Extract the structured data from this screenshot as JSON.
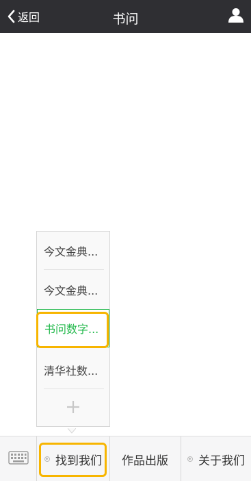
{
  "header": {
    "back_label": "返回",
    "title": "书问"
  },
  "submenu": {
    "items": [
      {
        "label": "今文金典..."
      },
      {
        "label": "今文金典..."
      },
      {
        "label": "书问数字..."
      },
      {
        "label": "清华社数..."
      }
    ],
    "active_index": 2,
    "active_color": "#20b84a"
  },
  "menubar": {
    "items": [
      {
        "label": "找到我们"
      },
      {
        "label": "作品出版"
      },
      {
        "label": "关于我们"
      }
    ]
  },
  "colors": {
    "topbar": "#2f2f33",
    "highlight": "#f7b500"
  },
  "icons": {
    "back": "chevron-left-icon",
    "user": "user-icon",
    "keyboard": "keyboard-icon",
    "plus": "plus-icon",
    "menu_dot": "dot-icon"
  }
}
